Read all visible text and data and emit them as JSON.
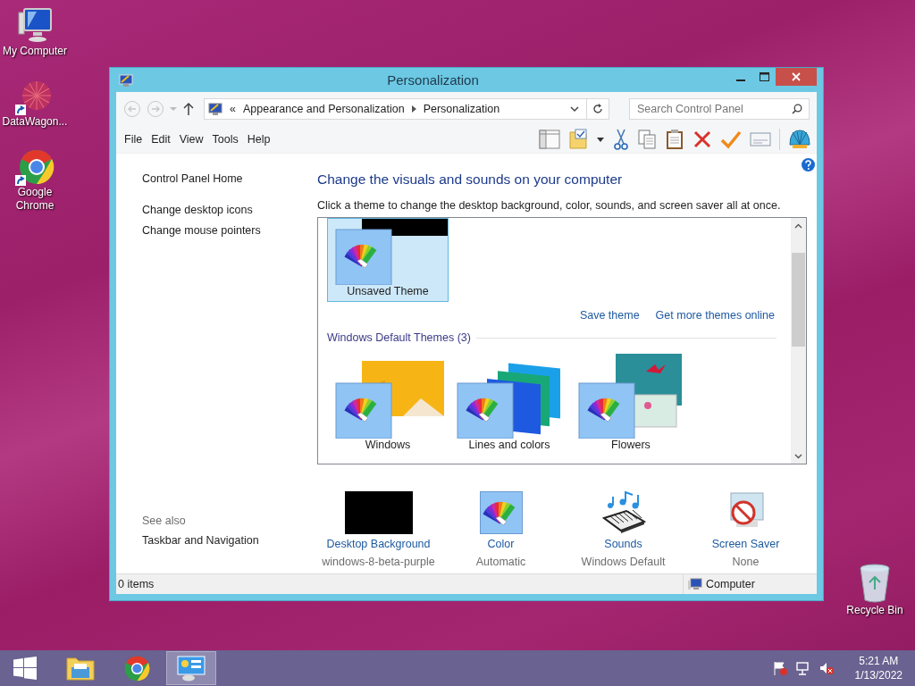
{
  "desktop_icons": [
    {
      "label": "My Computer",
      "kind": "computer",
      "shortcut": false
    },
    {
      "label": "DataWagon...",
      "kind": "datawagon",
      "shortcut": true
    },
    {
      "label": "Google Chrome",
      "kind": "chrome",
      "shortcut": true
    }
  ],
  "desktop_icons_right": [
    {
      "label": "Recycle Bin",
      "kind": "recycle",
      "shortcut": false
    }
  ],
  "window": {
    "title": "Personalization",
    "nav": [
      {
        "kind": "back",
        "disabled": true
      },
      {
        "kind": "forward",
        "disabled": true
      },
      {
        "kind": "up",
        "disabled": false
      }
    ],
    "address": {
      "prefix": "«",
      "crumbs": [
        "Appearance and Personalization",
        "Personalization"
      ]
    },
    "search": {
      "placeholder": "Search Control Panel"
    },
    "menu": [
      "File",
      "Edit",
      "View",
      "Tools",
      "Help"
    ],
    "sidebar": {
      "links": [
        "Control Panel Home",
        "Change desktop icons",
        "Change mouse pointers"
      ],
      "see_also_heading": "See also",
      "see_also": [
        "Taskbar and Navigation"
      ]
    },
    "content": {
      "heading": "Change the visuals and sounds on your computer",
      "description": "Click a theme to change the desktop background, color, sounds, and screen saver all at once.",
      "my_themes": [
        {
          "label": "Unsaved Theme",
          "kind": "black",
          "selected": true
        }
      ],
      "actions": [
        "Save theme",
        "Get more themes online"
      ],
      "group_heading": "Windows Default Themes (3)",
      "themes": [
        {
          "label": "Windows",
          "kind": "windows",
          "selected": false
        },
        {
          "label": "Lines and colors",
          "kind": "lines",
          "selected": false
        },
        {
          "label": "Flowers",
          "kind": "flowers",
          "selected": false
        }
      ]
    },
    "settings": [
      {
        "label": "Desktop Background",
        "value": "windows-8-beta-purple",
        "kind": "background"
      },
      {
        "label": "Color",
        "value": "Automatic",
        "kind": "color"
      },
      {
        "label": "Sounds",
        "value": "Windows Default",
        "kind": "sounds"
      },
      {
        "label": "Screen Saver",
        "value": "None",
        "kind": "screensaver"
      }
    ],
    "status_bar": {
      "items": "0 items",
      "location": "Computer"
    }
  },
  "taskbar": {
    "apps": [
      {
        "kind": "explorer",
        "active": false
      },
      {
        "kind": "chrome",
        "active": false
      },
      {
        "kind": "control-panel",
        "active": true
      }
    ],
    "time": "5:21 AM",
    "date": "1/13/2022"
  }
}
